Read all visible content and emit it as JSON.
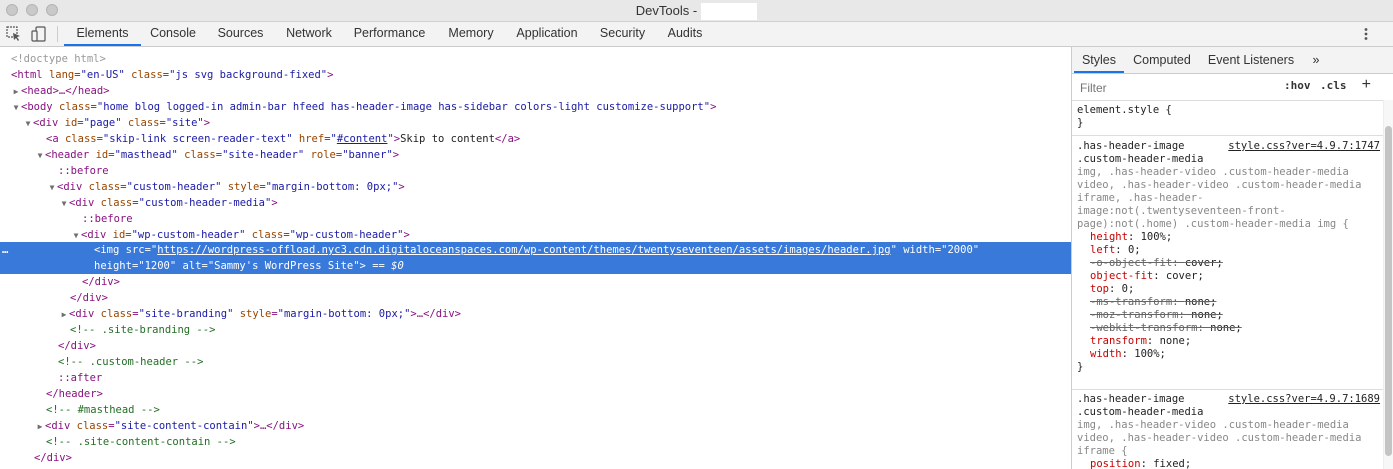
{
  "window": {
    "title": "DevTools -"
  },
  "toolbar": {
    "tabs": [
      "Elements",
      "Console",
      "Sources",
      "Network",
      "Performance",
      "Memory",
      "Application",
      "Security",
      "Audits"
    ],
    "active_tab": "Elements"
  },
  "dom": {
    "lines": [
      {
        "prefix": "<!doctype html>"
      },
      {
        "html_tag": "<html",
        "lang_attr": "lang",
        "lang_val": "\"en-US\"",
        "class_attr": "class",
        "class_val": "\"js svg background-fixed\"",
        "close": ">"
      },
      {
        "text": "<head>…</head>"
      },
      {
        "body_tag": "<body",
        "class_attr": "class",
        "class_val": "\"home blog logged-in admin-bar hfeed has-header-image has-sidebar colors-light customize-support\"",
        "close": ">"
      },
      {
        "tag": "<div",
        "a1": "id",
        "v1": "\"page\"",
        "a2": "class",
        "v2": "\"site\"",
        "close": ">"
      },
      {
        "tag": "<a",
        "a1": "class",
        "v1": "\"skip-link screen-reader-text\"",
        "a2": "href",
        "v2_link": "#content",
        "text": "Skip to content",
        "close_tag": "</a>"
      },
      {
        "tag": "<header",
        "a1": "id",
        "v1": "\"masthead\"",
        "a2": "class",
        "v2": "\"site-header\"",
        "a3": "role",
        "v3": "\"banner\"",
        "close": ">"
      },
      {
        "pseudo": "::before"
      },
      {
        "tag": "<div",
        "a1": "class",
        "v1": "\"custom-header\"",
        "a2": "style",
        "v2": "\"margin-bottom: 0px;\"",
        "close": ">"
      },
      {
        "tag": "<div",
        "a1": "class",
        "v1": "\"custom-header-media\"",
        "close": ">"
      },
      {
        "pseudo": "::before"
      },
      {
        "tag": "<div",
        "a1": "id",
        "v1": "\"wp-custom-header\"",
        "a2": "class",
        "v2": "\"wp-custom-header\"",
        "close": ">"
      },
      {
        "tag": "<img",
        "a1": "src",
        "v1_link": "https://wordpress-offload.nyc3.cdn.digitaloceanspaces.com/wp-content/themes/twentyseventeen/assets/images/header.jpg",
        "a2": "width",
        "v2": "\"2000\""
      },
      {
        "a1": "height",
        "v1": "\"1200\"",
        "a2": "alt",
        "v2": "\"Sammy's WordPress Site\"",
        "close": ">",
        "eq": "== $0"
      },
      {
        "text": "</div>"
      },
      {
        "text": "</div>"
      },
      {
        "tag": "<div",
        "a1": "class",
        "v1": "\"site-branding\"",
        "a2": "style",
        "v2": "\"margin-bottom: 0px;\"",
        "close": ">…</div>"
      },
      {
        "comment": "<!-- .site-branding -->"
      },
      {
        "text": "</div>"
      },
      {
        "comment": "<!-- .custom-header -->"
      },
      {
        "pseudo": "::after"
      },
      {
        "text": "</header>"
      },
      {
        "comment": "<!-- #masthead -->"
      },
      {
        "tag": "<div",
        "a1": "class",
        "v1": "\"site-content-contain\"",
        "close": ">…</div>"
      },
      {
        "comment": "<!-- .site-content-contain -->"
      },
      {
        "text": "</div>"
      }
    ]
  },
  "sidebar": {
    "tabs": [
      "Styles",
      "Computed",
      "Event Listeners",
      "»"
    ],
    "active_tab": "Styles",
    "filter_placeholder": "Filter",
    "hov": ":hov",
    "cls": ".cls",
    "plus": "+",
    "element_style": {
      "selector": "element.style {",
      "close": "}"
    },
    "rule1": {
      "source": "style.css?ver=4.9.7:1747",
      "selector_lines": [
        ".has-header-image",
        ".custom-header-media",
        "img, .has-header-video .custom-header-media",
        "video, .has-header-video .custom-header-media",
        "iframe, .has-header-",
        "image:not(.twentyseventeen-front-",
        "page):not(.home) .custom-header-media img {"
      ],
      "props": [
        {
          "name": "height",
          "value": "100%;",
          "struck": false
        },
        {
          "name": "left",
          "value": "0;",
          "struck": false
        },
        {
          "name": "-o-object-fit",
          "value": "cover;",
          "struck": true
        },
        {
          "name": "object-fit",
          "value": "cover;",
          "struck": false
        },
        {
          "name": "top",
          "value": "0;",
          "struck": false
        },
        {
          "name": "-ms-transform",
          "value": "none;",
          "struck": true
        },
        {
          "name": "-moz-transform",
          "value": "none;",
          "struck": true
        },
        {
          "name": "-webkit-transform",
          "value": "none;",
          "struck": true
        },
        {
          "name": "transform",
          "value": "none;",
          "struck": false
        },
        {
          "name": "width",
          "value": "100%;",
          "struck": false
        }
      ],
      "close": "}"
    },
    "rule2": {
      "source": "style.css?ver=4.9.7:1689",
      "selector_lines": [
        ".has-header-image",
        ".custom-header-media",
        "img, .has-header-video .custom-header-media",
        "video, .has-header-video .custom-header-media",
        "iframe {"
      ],
      "props": [
        {
          "name": "position",
          "value": "fixed;",
          "struck": false
        }
      ]
    }
  }
}
